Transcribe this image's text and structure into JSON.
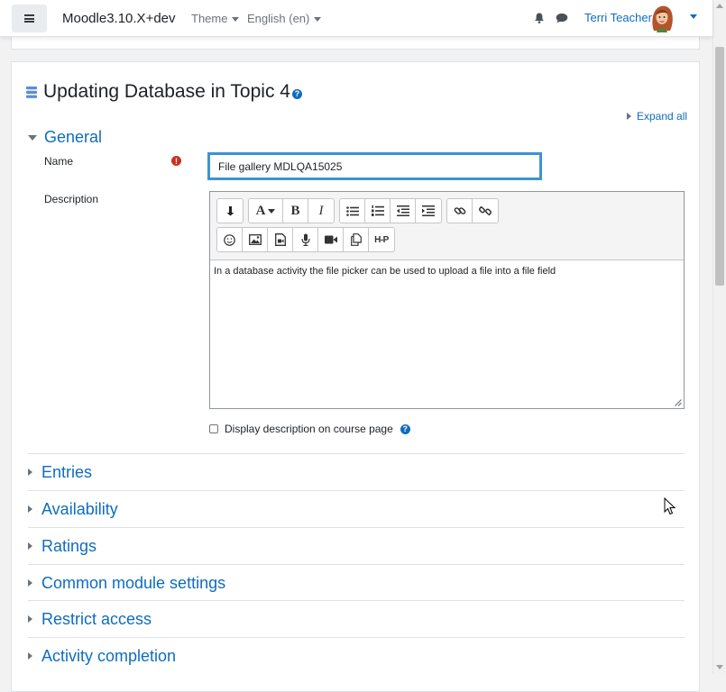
{
  "navbar": {
    "brand": "Moodle3.10.X+dev",
    "theme_label": "Theme",
    "language_label": "English (en)",
    "user_name": "Terri Teacher"
  },
  "page": {
    "title": "Updating Database in Topic 4",
    "expand_all": "Expand all"
  },
  "general": {
    "header": "General",
    "name_label": "Name",
    "name_value": "File gallery MDLQA15025",
    "description_label": "Description",
    "description_text": "In a database activity the file picker can be used to upload a file into a file field",
    "display_description_label": "Display description on course page"
  },
  "editor_toolbar": {
    "row1": [
      "show-more-icon",
      "font-color-icon",
      "bold-icon",
      "italic-icon",
      "unordered-list-icon",
      "ordered-list-icon",
      "outdent-icon",
      "indent-icon",
      "link-icon",
      "unlink-icon"
    ],
    "row2": [
      "emoticon-icon",
      "image-icon",
      "media-icon",
      "record-audio-icon",
      "record-video-icon",
      "manage-files-icon",
      "h5p-icon"
    ],
    "bold_glyph": "B",
    "italic_glyph": "I",
    "font_glyph": "A",
    "h5p_glyph": "H-P"
  },
  "sections": [
    {
      "label": "Entries"
    },
    {
      "label": "Availability"
    },
    {
      "label": "Ratings"
    },
    {
      "label": "Common module settings"
    },
    {
      "label": "Restrict access"
    },
    {
      "label": "Activity completion"
    }
  ],
  "colors": {
    "link": "#0f6cbf",
    "focus_border": "#3b93d5",
    "required": "#ca3120"
  }
}
